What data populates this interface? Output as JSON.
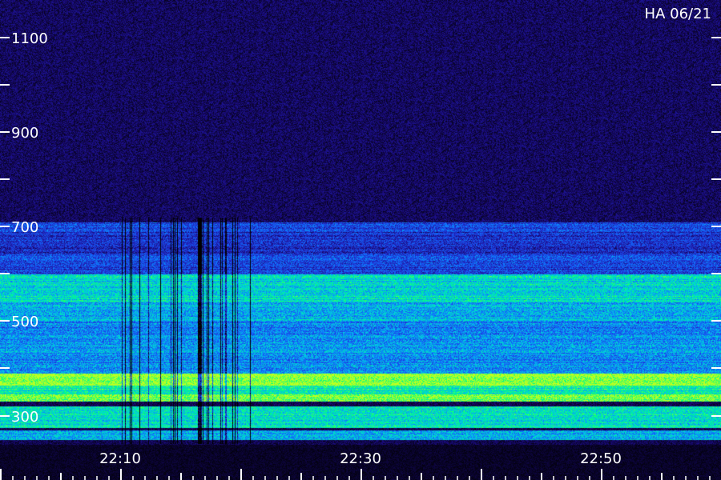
{
  "stamp": "HA 06/21",
  "chart_data": {
    "type": "heatmap",
    "title": "",
    "xlabel": "",
    "ylabel": "",
    "x_ticks": [
      "22:10",
      "22:30",
      "22:50"
    ],
    "x_tick_minutes": [
      10,
      30,
      50
    ],
    "x_range_minutes": [
      0,
      60
    ],
    "y_tick_labels": [
      "300",
      "500",
      "700",
      "900",
      "1100"
    ],
    "y_ticks": [
      300,
      400,
      500,
      600,
      700,
      800,
      900,
      1000,
      1100
    ],
    "y_range": [
      240,
      1230
    ],
    "colormap": [
      "#000000",
      "#1a0a7a",
      "#2030d0",
      "#1070ff",
      "#00d0e0",
      "#00ff80",
      "#c0ff20"
    ],
    "bands": [
      {
        "from": 250,
        "to": 270,
        "intensity": 0.6
      },
      {
        "from": 275,
        "to": 320,
        "intensity": 0.72
      },
      {
        "from": 330,
        "to": 345,
        "intensity": 0.95
      },
      {
        "from": 345,
        "to": 365,
        "intensity": 0.78
      },
      {
        "from": 365,
        "to": 390,
        "intensity": 0.98
      },
      {
        "from": 390,
        "to": 470,
        "intensity": 0.55
      },
      {
        "from": 470,
        "to": 500,
        "intensity": 0.52
      },
      {
        "from": 500,
        "to": 540,
        "intensity": 0.62
      },
      {
        "from": 540,
        "to": 560,
        "intensity": 0.72
      },
      {
        "from": 560,
        "to": 600,
        "intensity": 0.7
      },
      {
        "from": 600,
        "to": 640,
        "intensity": 0.38
      },
      {
        "from": 640,
        "to": 690,
        "intensity": 0.32
      },
      {
        "from": 690,
        "to": 710,
        "intensity": 0.4
      },
      {
        "from": 710,
        "to": 1230,
        "intensity": 0.12
      }
    ],
    "interference_window_minutes": [
      8,
      21
    ]
  },
  "colors": {
    "tick": "#ffffff",
    "background": "#000000"
  }
}
